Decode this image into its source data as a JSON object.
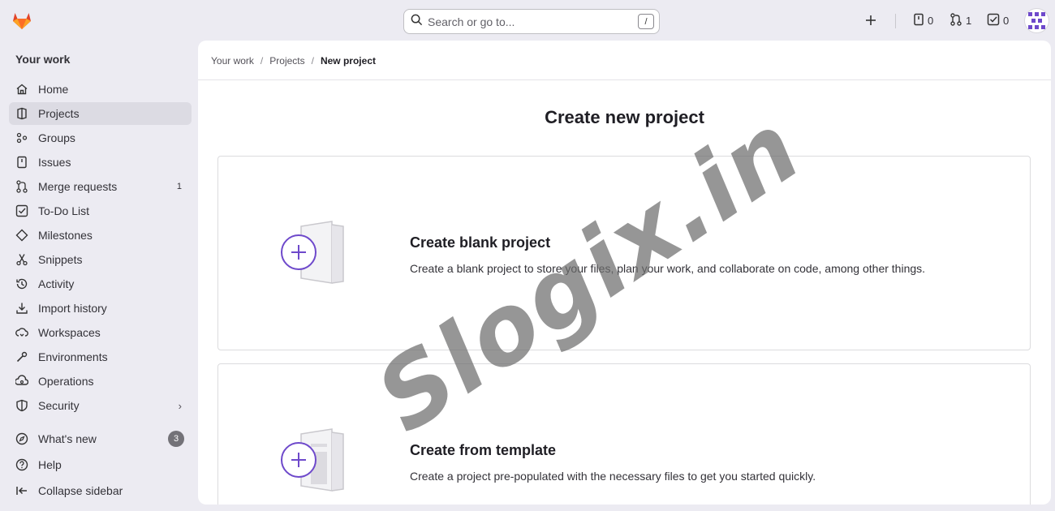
{
  "search": {
    "placeholder": "Search or go to...",
    "shortcut": "/"
  },
  "top_actions": {
    "issues_count": "0",
    "merge_requests_count": "1",
    "todos_count": "0"
  },
  "sidebar": {
    "context": "Your work",
    "items": [
      {
        "label": "Home",
        "icon": "home-icon"
      },
      {
        "label": "Projects",
        "icon": "project-icon",
        "active": true
      },
      {
        "label": "Groups",
        "icon": "group-icon"
      },
      {
        "label": "Issues",
        "icon": "issues-icon"
      },
      {
        "label": "Merge requests",
        "icon": "merge-request-icon",
        "badge": "1"
      },
      {
        "label": "To-Do List",
        "icon": "todo-icon"
      },
      {
        "label": "Milestones",
        "icon": "milestone-icon"
      },
      {
        "label": "Snippets",
        "icon": "snippet-icon"
      },
      {
        "label": "Activity",
        "icon": "history-icon"
      },
      {
        "label": "Import history",
        "icon": "import-icon"
      },
      {
        "label": "Workspaces",
        "icon": "workspace-icon"
      },
      {
        "label": "Environments",
        "icon": "environment-icon"
      },
      {
        "label": "Operations",
        "icon": "operations-icon"
      },
      {
        "label": "Security",
        "icon": "shield-icon"
      }
    ],
    "footer": [
      {
        "label": "What's new",
        "icon": "compass-icon",
        "badge": "3"
      },
      {
        "label": "Help",
        "icon": "help-icon"
      },
      {
        "label": "Collapse sidebar",
        "icon": "collapse-icon"
      }
    ]
  },
  "breadcrumb": {
    "item1": "Your work",
    "item2": "Projects",
    "current": "New project"
  },
  "page": {
    "title": "Create new project"
  },
  "cards": [
    {
      "title": "Create blank project",
      "description": "Create a blank project to store your files, plan your work, and collaborate on code, among other things."
    },
    {
      "title": "Create from template",
      "description": "Create a project pre-populated with the necessary files to get you started quickly."
    }
  ],
  "watermark": "Slogix.in",
  "colors": {
    "accent": "#6e49cb",
    "logo": "#e24329",
    "active_bg": "#dcdbe3"
  }
}
